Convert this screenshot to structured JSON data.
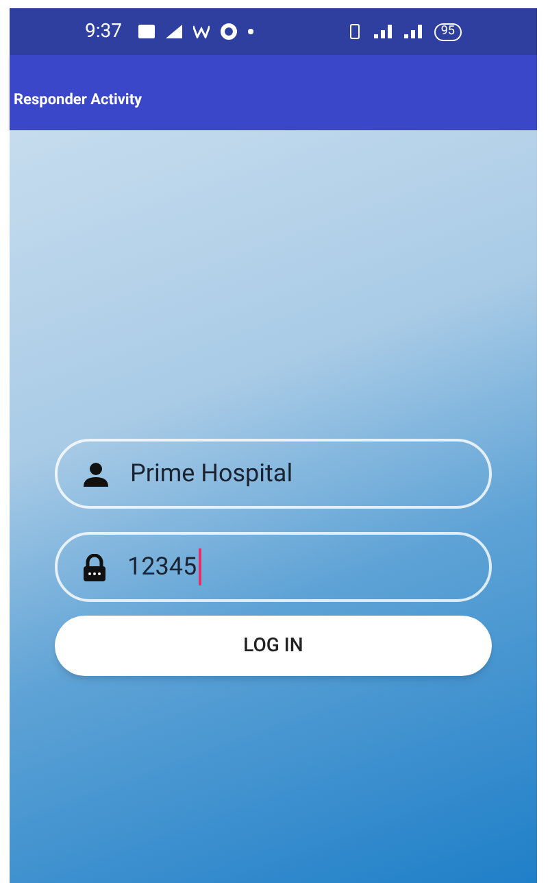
{
  "status_bar": {
    "time": "9:37",
    "battery": "95"
  },
  "app_bar": {
    "title": "Responder Activity"
  },
  "login": {
    "username": {
      "value": "Prime Hospital"
    },
    "password": {
      "value": "12345",
      "focused": true
    },
    "button": "LOG IN"
  }
}
